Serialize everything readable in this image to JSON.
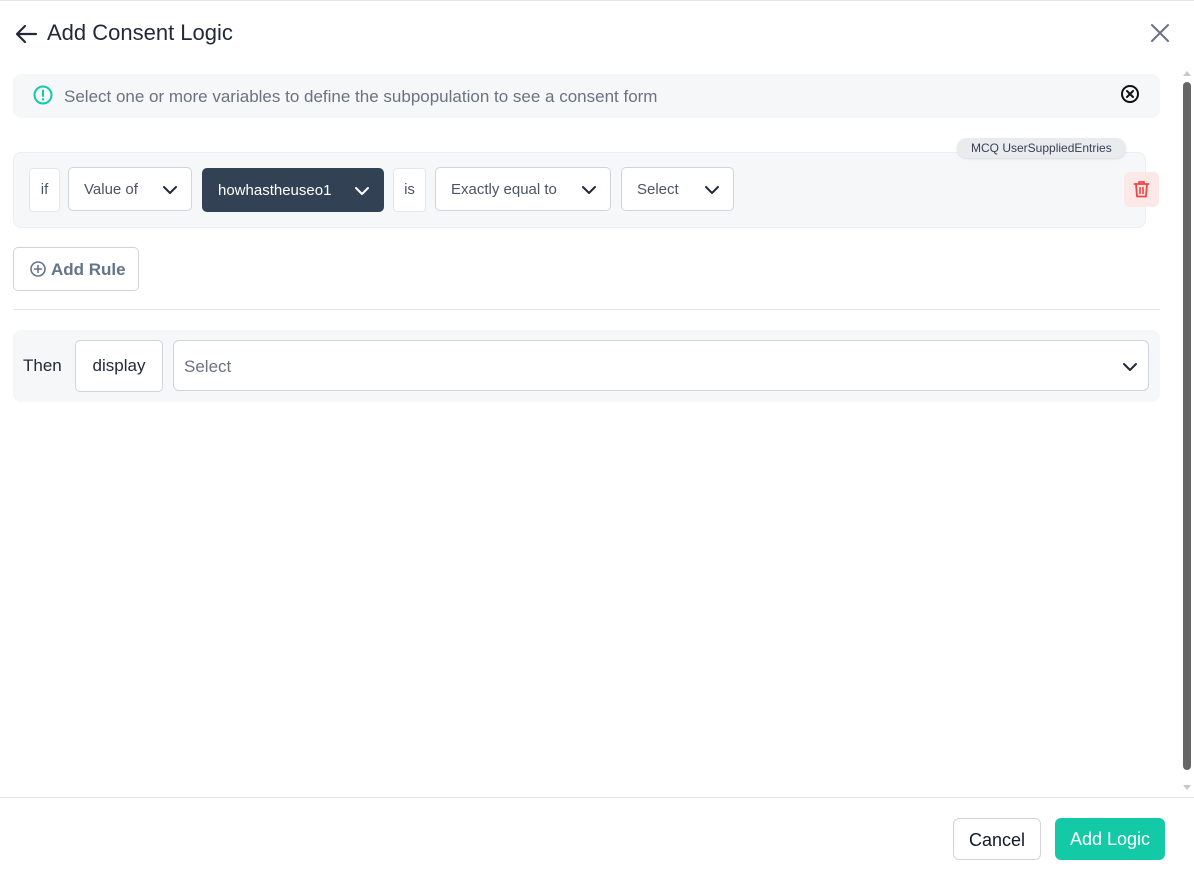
{
  "header": {
    "title": "Add Consent Logic",
    "back_icon": "arrow-left-icon",
    "close_icon": "close-icon"
  },
  "info_banner": {
    "text": "Select one or more variables to define the subpopulation to see a consent form",
    "icon": "info-circle-icon",
    "close_icon": "close-circle-icon"
  },
  "rule": {
    "chip": "MCQ UserSuppliedEntries",
    "if_label": "if",
    "value_of": "Value of",
    "variable": "howhastheuseo1",
    "is_label": "is",
    "operator": "Exactly equal to",
    "value": "Select",
    "delete_icon": "trash-icon"
  },
  "add_rule": {
    "label": "Add Rule",
    "icon": "plus-circle-icon"
  },
  "then": {
    "label": "Then",
    "action": "display",
    "target_placeholder": "Select"
  },
  "footer": {
    "cancel_label": "Cancel",
    "submit_label": "Add Logic"
  },
  "colors": {
    "accent": "#14c9a6",
    "dark_select": "#334155",
    "danger": "#ef4444",
    "danger_bg": "#fde8e8"
  }
}
